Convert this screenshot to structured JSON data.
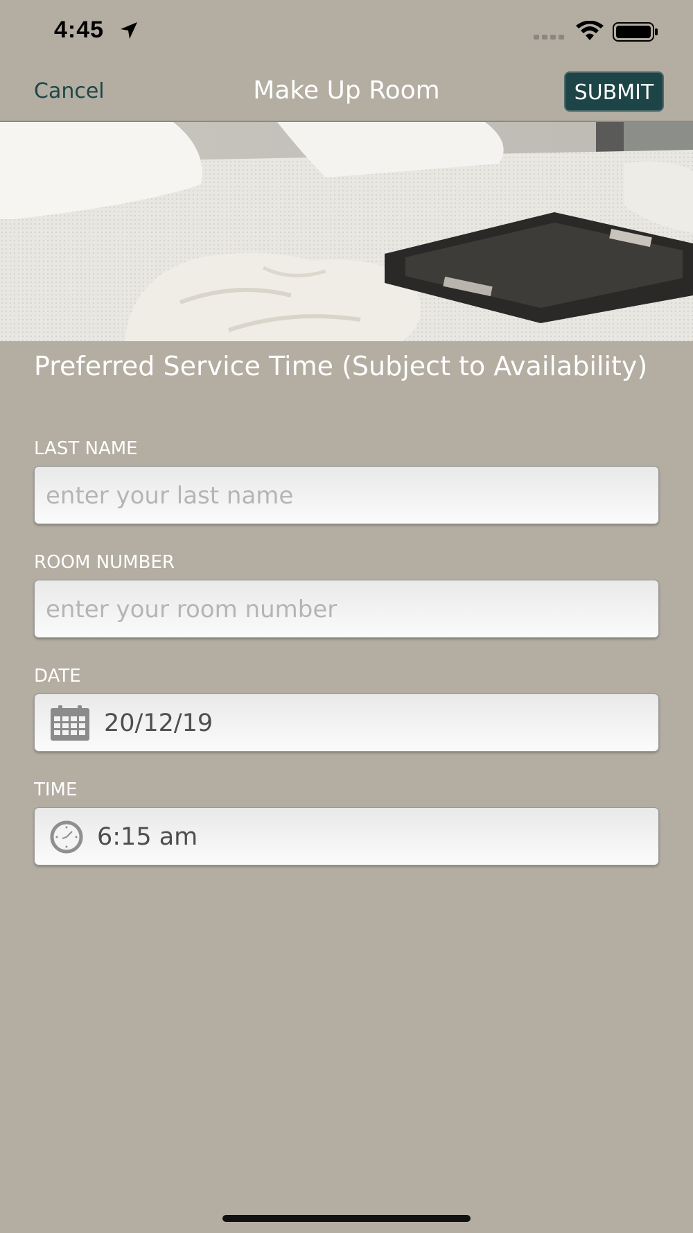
{
  "status_bar": {
    "time": "4:45",
    "location_icon": "location-arrow-icon",
    "signal_icon": "cellular-signal-icon",
    "wifi_icon": "wifi-icon",
    "battery_icon": "battery-icon"
  },
  "nav": {
    "cancel_label": "Cancel",
    "title": "Make Up Room",
    "submit_label": "SUBMIT"
  },
  "hero": {
    "description_icon": "hotel-room-photo"
  },
  "form": {
    "section_title": "Preferred Service Time (Subject to Availability)",
    "last_name": {
      "label": "LAST NAME",
      "placeholder": "enter your last name",
      "value": ""
    },
    "room_number": {
      "label": "ROOM NUMBER",
      "placeholder": "enter your room number",
      "value": ""
    },
    "date": {
      "label": "DATE",
      "value": "20/12/19",
      "icon": "calendar-icon"
    },
    "time": {
      "label": "TIME",
      "value": "6:15 am",
      "icon": "clock-icon"
    }
  },
  "colors": {
    "background": "#b3ada2",
    "accent": "#1d4447",
    "cancel_text": "#1e4648"
  }
}
